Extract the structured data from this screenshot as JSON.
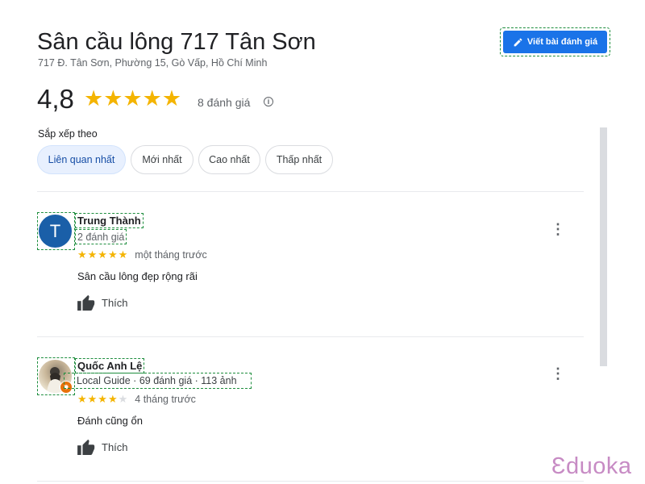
{
  "place": {
    "title": "Sân cầu lông 717 Tân Sơn",
    "address": "717 Đ. Tân Sơn, Phường 15, Gò Vấp, Hồ Chí Minh"
  },
  "write_review_label": "Viết bài đánh giá",
  "summary": {
    "rating": "4,8",
    "stars": "★★★★★",
    "count_label": "8 đánh giá"
  },
  "sort": {
    "label": "Sắp xếp theo",
    "options": [
      "Liên quan nhất",
      "Mới nhất",
      "Cao nhất",
      "Thấp nhất"
    ],
    "selected": "Liên quan nhất"
  },
  "reviews": [
    {
      "avatar_initial": "T",
      "name": "Trung Thành",
      "meta": "2 đánh giá",
      "stars_filled": "★★★★★",
      "stars_empty": "",
      "rating": 5,
      "time": "một tháng trước",
      "text": "Sân cầu lông đẹp rộng rãi",
      "like_label": "Thích"
    },
    {
      "avatar_initial": "",
      "name": "Quốc Anh Lệ",
      "meta": "Local Guide · 69 đánh giá · 113 ảnh",
      "stars_filled": "★★★★",
      "stars_empty": "★",
      "rating": 4,
      "time": "4 tháng trước",
      "text": "Đánh cũng ổn",
      "like_label": "Thích"
    }
  ],
  "watermark": "Ɛduoka",
  "colors": {
    "accent_blue": "#1a73e8",
    "star_yellow": "#f4b400",
    "chip_active_bg": "#e8f0fe",
    "local_guide_badge": "#e8710a",
    "watermark_pink": "#c78bc4"
  }
}
